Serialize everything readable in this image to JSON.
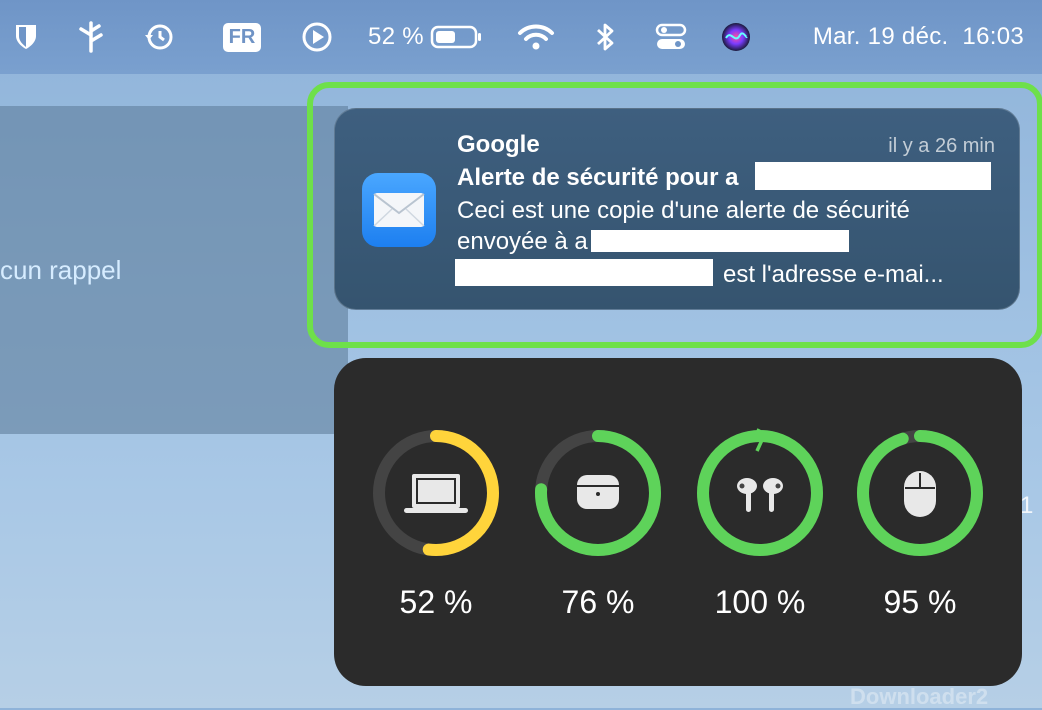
{
  "menubar": {
    "items": [
      {
        "name": "shield-icon"
      },
      {
        "name": "bolt-fork-icon"
      },
      {
        "name": "time-machine-icon"
      },
      {
        "name": "input-source",
        "label": "FR"
      },
      {
        "name": "play-icon"
      },
      {
        "name": "battery-percent",
        "label": "52 %"
      },
      {
        "name": "battery-icon"
      },
      {
        "name": "wifi-icon"
      },
      {
        "name": "bluetooth-icon"
      },
      {
        "name": "control-center-icon"
      },
      {
        "name": "siri-icon"
      }
    ],
    "datetime": "Mar. 19 déc.  16:03"
  },
  "background": {
    "reminder_text": "cun rappel",
    "digit": "1",
    "app_label": "Downloader2"
  },
  "notification": {
    "app": "Google",
    "time": "il y a 26 min",
    "title": "Alerte de sécurité pour a",
    "line1": "Ceci est une copie d'une alerte de sécurité",
    "line2": "envoyée à a",
    "line3": "est l'adresse e-mai...",
    "icon": "mail-icon"
  },
  "battery_widget": {
    "devices": [
      {
        "name": "macbook",
        "icon": "laptop-icon",
        "label": "52 %",
        "level": 52,
        "color": "#ffd43b"
      },
      {
        "name": "airpods-case",
        "icon": "airpods-case-icon",
        "label": "76 %",
        "level": 76,
        "color": "#5ed35a"
      },
      {
        "name": "airpods-pro",
        "icon": "airpods-icon",
        "label": "100 %",
        "level": 100,
        "color": "#5ed35a",
        "charging": true
      },
      {
        "name": "magic-mouse",
        "icon": "mouse-icon",
        "label": "95 %",
        "level": 95,
        "color": "#5ed35a"
      }
    ]
  }
}
